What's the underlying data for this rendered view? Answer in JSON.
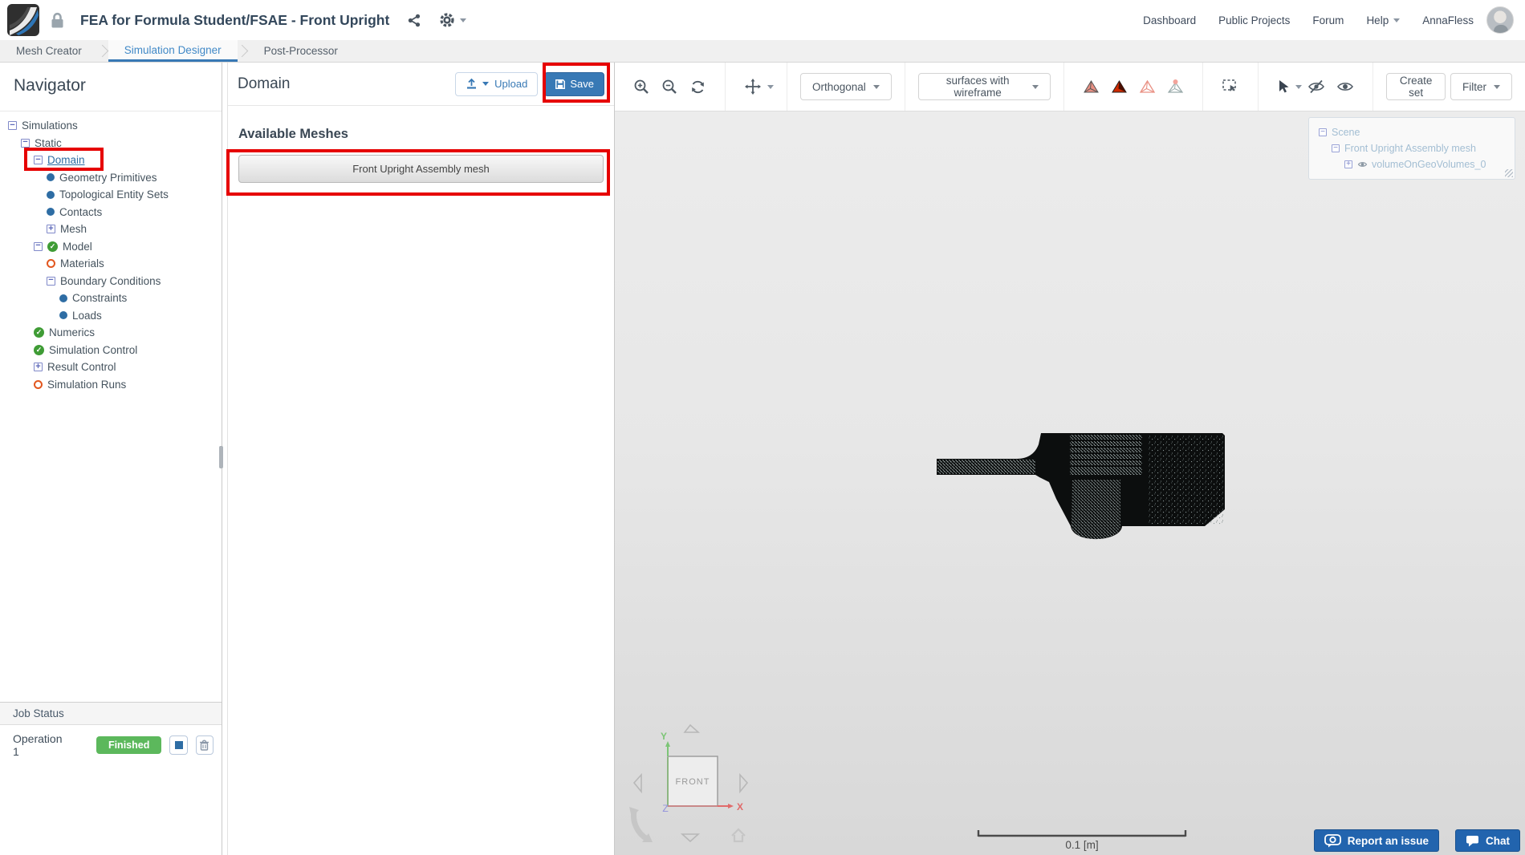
{
  "header": {
    "title": "FEA for Formula Student/FSAE - Front Upright",
    "nav": {
      "dashboard": "Dashboard",
      "public_projects": "Public Projects",
      "forum": "Forum",
      "help": "Help",
      "username": "AnnaFless"
    }
  },
  "tabs": {
    "mesh_creator": "Mesh Creator",
    "simulation_designer": "Simulation Designer",
    "post_processor": "Post-Processor"
  },
  "navigator": {
    "title": "Navigator",
    "tree": [
      {
        "label": "Simulations"
      },
      {
        "label": "Static"
      },
      {
        "label": "Domain"
      },
      {
        "label": "Geometry Primitives"
      },
      {
        "label": "Topological Entity Sets"
      },
      {
        "label": "Contacts"
      },
      {
        "label": "Mesh"
      },
      {
        "label": "Model"
      },
      {
        "label": "Materials"
      },
      {
        "label": "Boundary Conditions"
      },
      {
        "label": "Constraints"
      },
      {
        "label": "Loads"
      },
      {
        "label": "Numerics"
      },
      {
        "label": "Simulation Control"
      },
      {
        "label": "Result Control"
      },
      {
        "label": "Simulation Runs"
      }
    ],
    "job_status": {
      "title": "Job Status",
      "operation": "Operation 1",
      "status": "Finished"
    }
  },
  "domain_panel": {
    "title": "Domain",
    "upload_label": "Upload",
    "save_label": "Save",
    "section_title": "Available Meshes",
    "mesh_button_label": "Front Upright Assembly mesh"
  },
  "viewport": {
    "toolbar": {
      "projection": "Orthogonal",
      "render_mode": "surfaces with wireframe",
      "create_set": "Create set",
      "filter": "Filter"
    },
    "scene_tree": {
      "root": "Scene",
      "mesh": "Front Upright Assembly mesh",
      "volume": "volumeOnGeoVolumes_0"
    },
    "nav_cube": {
      "face": "FRONT",
      "x": "X",
      "y": "Y",
      "z": "Z"
    },
    "scale_label": "0.1 [m]",
    "report_issue": "Report an issue",
    "chat": "Chat"
  },
  "colors": {
    "accent_blue": "#3879b5",
    "annotation_red": "#e60000",
    "finished_green": "#5cb85c"
  }
}
